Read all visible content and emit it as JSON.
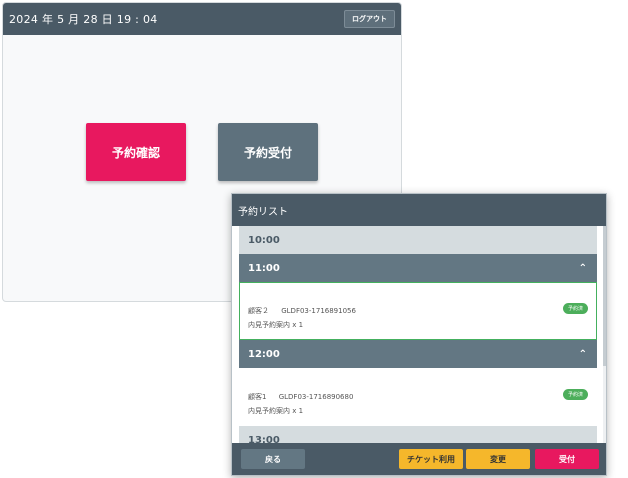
{
  "main": {
    "datetime": "2024 年 5 月 28 日  19 : 04",
    "logout_label": "ログアウト",
    "confirm_label": "予約確認",
    "reception_label": "予約受付"
  },
  "modal": {
    "title": "予約リスト",
    "groups": [
      {
        "time": "10:00"
      },
      {
        "time": "11:00",
        "entry": {
          "customer": "顧客２",
          "code": "GLDF03-1716891056",
          "detail": "内見予約案内 x 1",
          "badge": "予約済"
        }
      },
      {
        "time": "12:00",
        "entry": {
          "customer": "顧客1",
          "code": "GLDF03-1716890680",
          "detail": "内見予約案内 x 1",
          "badge": "予約済"
        }
      },
      {
        "time": "13:00"
      }
    ],
    "footer": {
      "back_label": "戻る",
      "ticket_label": "チケット利用",
      "change_label": "変更",
      "accept_label": "受付"
    }
  },
  "colors": {
    "header_bg": "#4a5a66",
    "primary_pink": "#e8185f",
    "slate": "#5e717d",
    "amber": "#f5b72b",
    "success_green": "#4cae5b"
  },
  "icons": {
    "expanded_chevron": "chevron-up-icon"
  }
}
